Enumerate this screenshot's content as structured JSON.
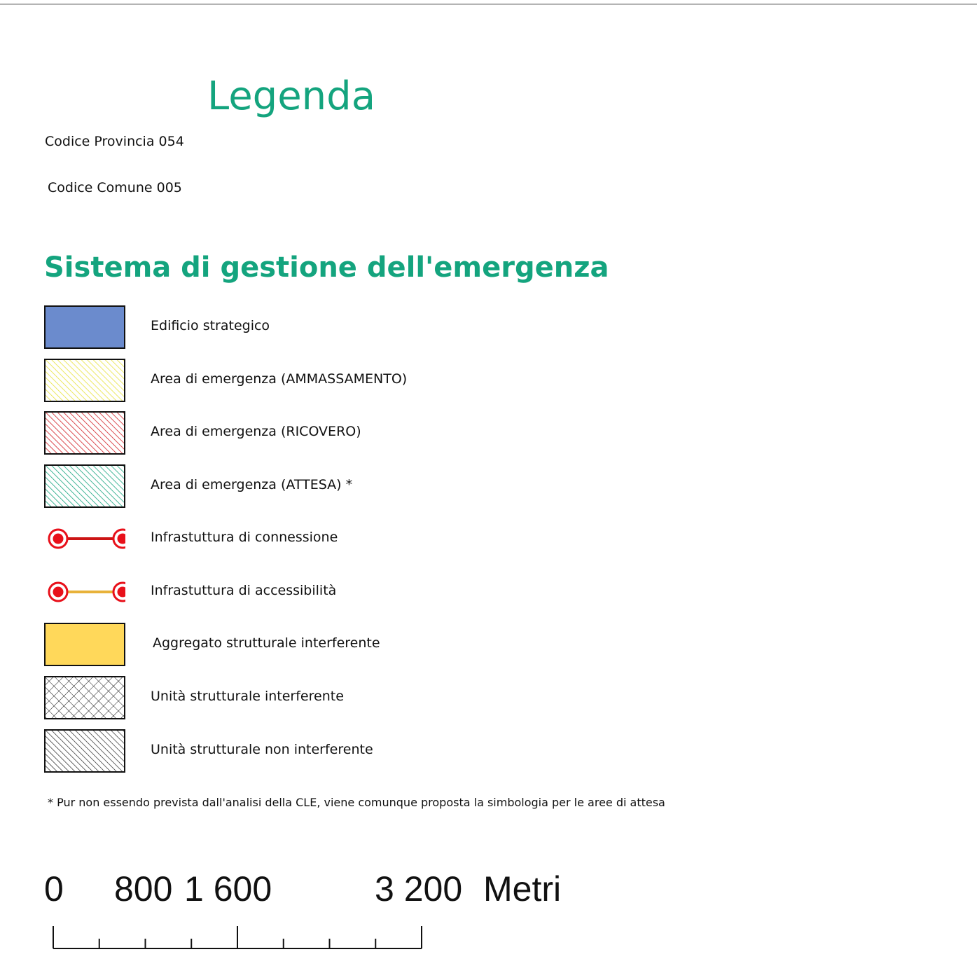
{
  "legend": {
    "title": "Legenda",
    "codice_provincia": "Codice Provincia 054",
    "codice_comune": "Codice Comune 005",
    "section_title": "Sistema di gestione dell'emergenza",
    "items": [
      {
        "label": "Edificio strategico",
        "symbol": "solid-fill",
        "color": "#6b8bcd"
      },
      {
        "label": "Area di emergenza (AMMASSAMENTO)",
        "symbol": "diagonal-hatch",
        "color": "#e8e23a"
      },
      {
        "label": "Area di emergenza (RICOVERO)",
        "symbol": "diagonal-hatch",
        "color": "#d21e24"
      },
      {
        "label": "Area di emergenza (ATTESA) *",
        "symbol": "diagonal-hatch",
        "color": "#14a47e"
      },
      {
        "label": "Infrastuttura di connessione",
        "symbol": "line-with-nodes",
        "color": "#cc1414"
      },
      {
        "label": "Infrastuttura di accessibilità",
        "symbol": "line-with-nodes",
        "color": "#e8b23a"
      },
      {
        "label": "Aggregato strutturale interferente",
        "symbol": "solid-fill",
        "color": "#ffd85a"
      },
      {
        "label": "Unità strutturale interferente",
        "symbol": "cross-hatch",
        "color": "#111111"
      },
      {
        "label": "Unità strutturale non interferente",
        "symbol": "diagonal-hatch",
        "color": "#111111"
      }
    ],
    "node_color": "#e8101a",
    "note": "* Pur non essendo prevista dall'analisi della CLE, viene comunque proposta la simbologia per le aree di attesa"
  },
  "scale_bar": {
    "labels": [
      "0",
      "800",
      "1 600",
      "3 200"
    ],
    "unit": "Metri",
    "max_value": 3200,
    "tick_step": 400
  }
}
